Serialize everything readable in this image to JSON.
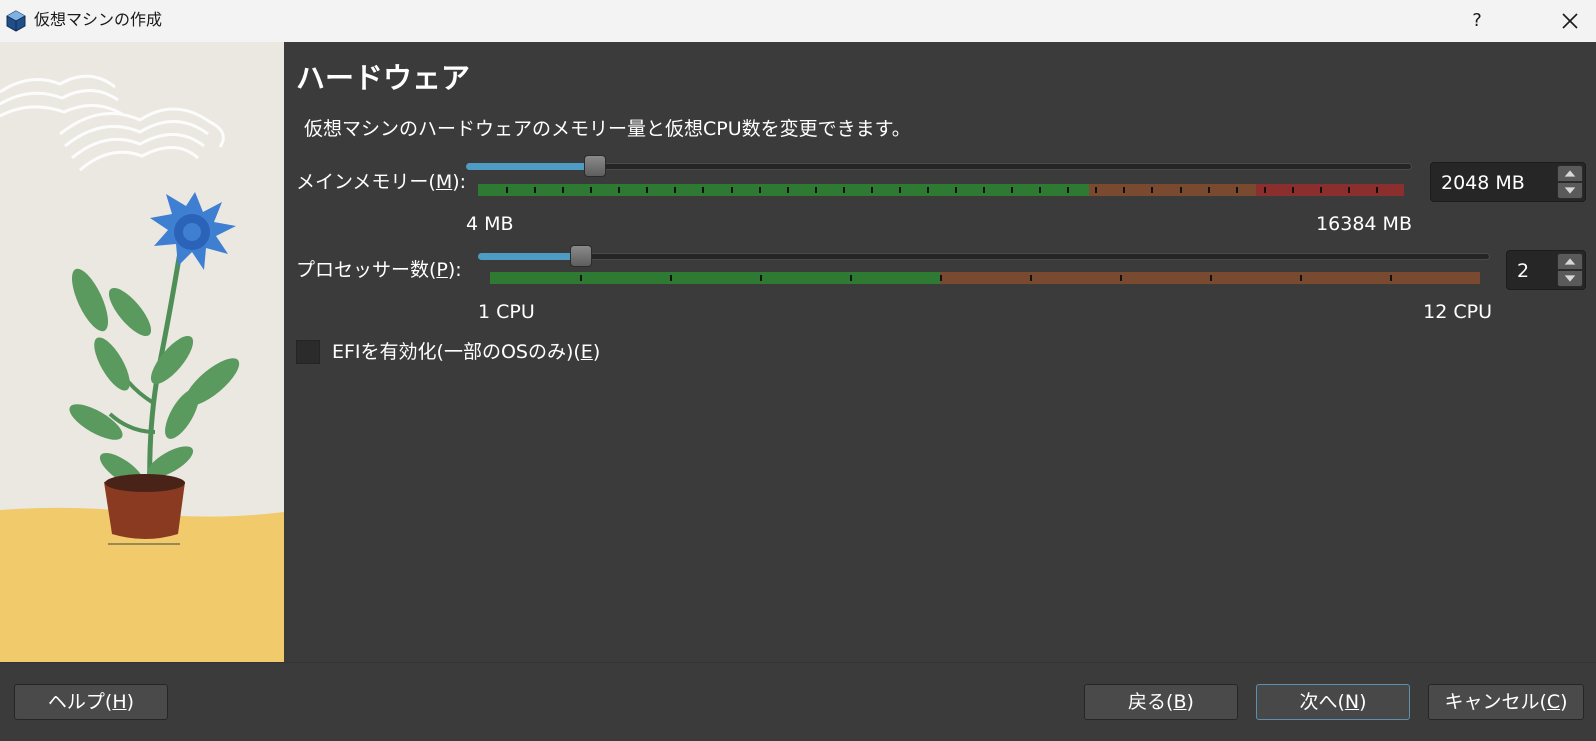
{
  "window": {
    "title": "仮想マシンの作成",
    "help_glyph": "?",
    "app_icon": "virtualbox-cube-icon"
  },
  "page": {
    "title": "ハードウェア",
    "description": "仮想マシンのハードウェアのメモリー量と仮想CPU数を変更できます。"
  },
  "memory": {
    "label_prefix": "メインメモリー(",
    "label_mnemonic": "M",
    "label_suffix": "):",
    "min_label": "4 MB",
    "max_label": "16384 MB",
    "value_text": "2048 MB",
    "value": 2048,
    "min": 4,
    "max": 16384,
    "recommended_fraction": 0.66,
    "warning_fraction": 0.84
  },
  "cpu": {
    "label_prefix": "プロセッサー数(",
    "label_mnemonic": "P",
    "label_suffix": "):",
    "min_label": "1 CPU",
    "max_label": "12 CPU",
    "value_text": "2",
    "value": 2,
    "min": 1,
    "max": 12,
    "recommended_fraction": 0.455
  },
  "efi": {
    "label_prefix": "EFIを有効化(一部のOSのみ)(",
    "label_mnemonic": "E",
    "label_suffix": ")",
    "checked": false
  },
  "buttons": {
    "help": {
      "prefix": "ヘルプ(",
      "mnemonic": "H",
      "suffix": ")"
    },
    "back": {
      "prefix": "戻る(",
      "mnemonic": "B",
      "suffix": ")"
    },
    "next": {
      "prefix": "次へ(",
      "mnemonic": "N",
      "suffix": ")"
    },
    "cancel": {
      "prefix": "キャンセル(",
      "mnemonic": "C",
      "suffix": ")"
    }
  },
  "colors": {
    "band_green": "#2e7a33",
    "band_orange": "#7a4a30",
    "band_red": "#8a2e2e",
    "slider_fill": "#4e9cc4"
  }
}
